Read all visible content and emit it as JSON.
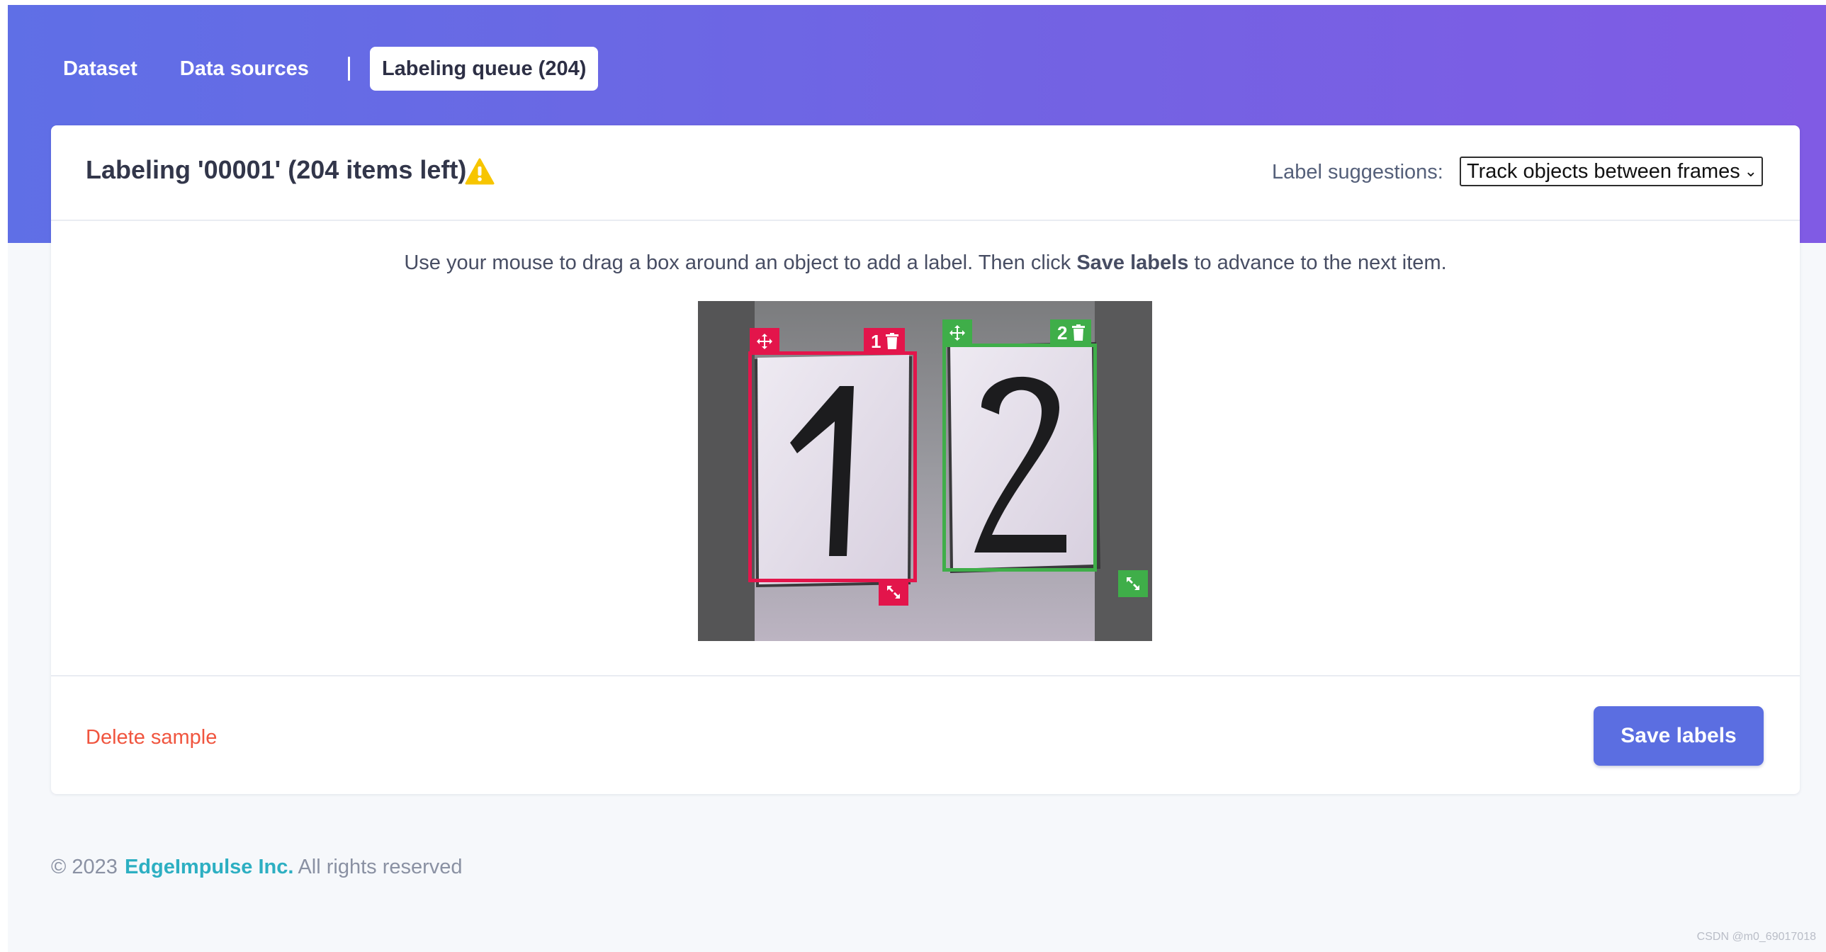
{
  "nav": {
    "tabs": [
      {
        "label": "Dataset"
      },
      {
        "label": "Data sources"
      },
      {
        "label": "Labeling queue (204)"
      }
    ],
    "active_tab": "Labeling queue (204)"
  },
  "card": {
    "title": "Labeling '00001' (204 items left)",
    "warning_icon": "warning-triangle-icon",
    "suggestions": {
      "label": "Label suggestions:",
      "selected": "Track objects between frames"
    },
    "instruction": {
      "before": "Use your mouse to drag a box around an object to add a label. Then click ",
      "bold": "Save labels",
      "after": " to advance to the next item."
    },
    "boxes": [
      {
        "label": "1",
        "color": "#e3154b"
      },
      {
        "label": "2",
        "color": "#3fae49"
      }
    ],
    "delete_label": "Delete sample",
    "save_label": "Save labels"
  },
  "footer": {
    "copyright": "© 2023",
    "company": "EdgeImpulse Inc.",
    "rights": "All rights reserved"
  },
  "watermark": "CSDN @m0_69017018",
  "colors": {
    "banner_start": "#5f6fe6",
    "banner_end": "#805be4",
    "accent": "#5b6ee1",
    "danger": "#f0553f",
    "link": "#2dafc2",
    "warning": "#f7c500"
  }
}
